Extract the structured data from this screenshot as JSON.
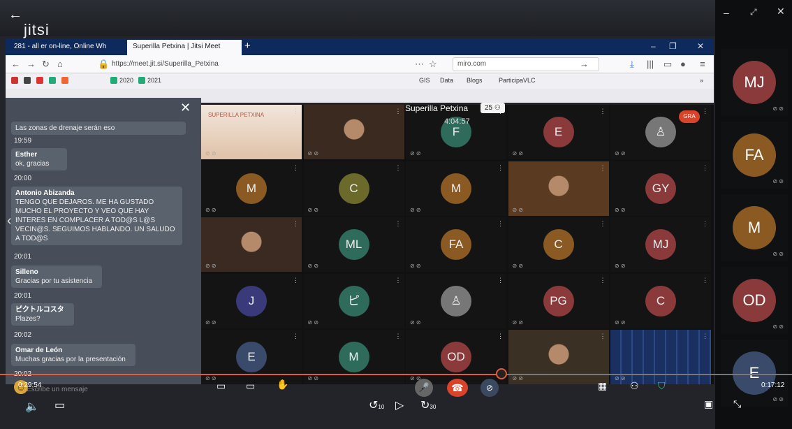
{
  "jitsi": {
    "logo": "jitsi"
  },
  "browser": {
    "tabs": [
      {
        "label": "281 - all er on-line, Online Wh"
      },
      {
        "label": "Superilla Petxina | Jitsi Meet"
      }
    ],
    "url": "https://meet.jit.si/Superilla_Petxina",
    "search_placeholder": "miro.com",
    "bookmarks": [
      "2020",
      "2021",
      "GIS",
      "Data",
      "Blogs",
      "ParticipaVLC"
    ]
  },
  "chat": {
    "messages": [
      {
        "text": "Las zonas de drenaje serán eso"
      },
      {
        "time": "19:59"
      },
      {
        "who": "Esther",
        "text": "ok, gracias"
      },
      {
        "time": "20:00"
      },
      {
        "who": "Antonio Abizanda",
        "text": "TENGO QUE DEJAROS. ME HA GUSTADO MUCHO EL PROYECTO Y VEO QUE HAY INTERES EN COMPLACER A TOD@S L@S VECIN@S. SEGUIMOS HABLANDO. UN SALUDO A TOD@S"
      },
      {
        "time": "20:01"
      },
      {
        "who": "Silleno",
        "text": "Gracias por tu asistencia"
      },
      {
        "time": "20:01"
      },
      {
        "who": "ピクトルコスタ",
        "text": "Plazes?"
      },
      {
        "time": "20:02"
      },
      {
        "who": "Omar de León",
        "text": "Muchas gracias por la presentación"
      },
      {
        "time": "20:02"
      }
    ],
    "input_placeholder": "Escribe un mensaje"
  },
  "meeting": {
    "title": "Superilla Petxina",
    "participants": "25",
    "timer": "4:04:57"
  },
  "grid": {
    "tiles": [
      {
        "initials": "",
        "color": "#2a2a2a",
        "kind": "slide",
        "label": "SUPERILLA PETXINA"
      },
      {
        "initials": "",
        "color": "#3a2a20",
        "kind": "video"
      },
      {
        "initials": "F",
        "color": "#2e6b5a"
      },
      {
        "initials": "E",
        "color": "#8a3a3a"
      },
      {
        "initials": "",
        "color": "#777",
        "kind": "user"
      },
      {
        "initials": "M",
        "color": "#8a5a22"
      },
      {
        "initials": "C",
        "color": "#6b6a2a"
      },
      {
        "initials": "M",
        "color": "#8a5a22"
      },
      {
        "initials": "",
        "color": "#5a3a20",
        "kind": "video"
      },
      {
        "initials": "GY",
        "color": "#8a3a3a"
      },
      {
        "initials": "",
        "color": "#3a2a22",
        "kind": "video"
      },
      {
        "initials": "ML",
        "color": "#2e6b5a"
      },
      {
        "initials": "FA",
        "color": "#8a5a22"
      },
      {
        "initials": "C",
        "color": "#8a5a22"
      },
      {
        "initials": "MJ",
        "color": "#8a3a3a"
      },
      {
        "initials": "J",
        "color": "#3a3a7a"
      },
      {
        "initials": "ピ",
        "color": "#2e6b5a"
      },
      {
        "initials": "",
        "color": "#777",
        "kind": "user"
      },
      {
        "initials": "PG",
        "color": "#8a3a3a"
      },
      {
        "initials": "C",
        "color": "#8a3a3a"
      },
      {
        "initials": "E",
        "color": "#3a4a6a"
      },
      {
        "initials": "M",
        "color": "#2e6b5a"
      },
      {
        "initials": "OD",
        "color": "#8a3a3a"
      },
      {
        "initials": "",
        "color": "#3a3024",
        "kind": "video"
      },
      {
        "initials": "",
        "color": "#1a3060",
        "kind": "screen"
      }
    ]
  },
  "side": {
    "tiles": [
      {
        "initials": "MJ",
        "color": "#8a3a3a"
      },
      {
        "initials": "FA",
        "color": "#8a5a22"
      },
      {
        "initials": "M",
        "color": "#8a5a22"
      },
      {
        "initials": "OD",
        "color": "#8a3a3a"
      },
      {
        "initials": "E",
        "color": "#3a4a6a"
      }
    ]
  },
  "player": {
    "elapsed": "0:29:54",
    "remaining": "0:17:12",
    "skip_back": "10",
    "skip_fwd": "30",
    "progress": 0.633
  },
  "gra_label": "GRA"
}
